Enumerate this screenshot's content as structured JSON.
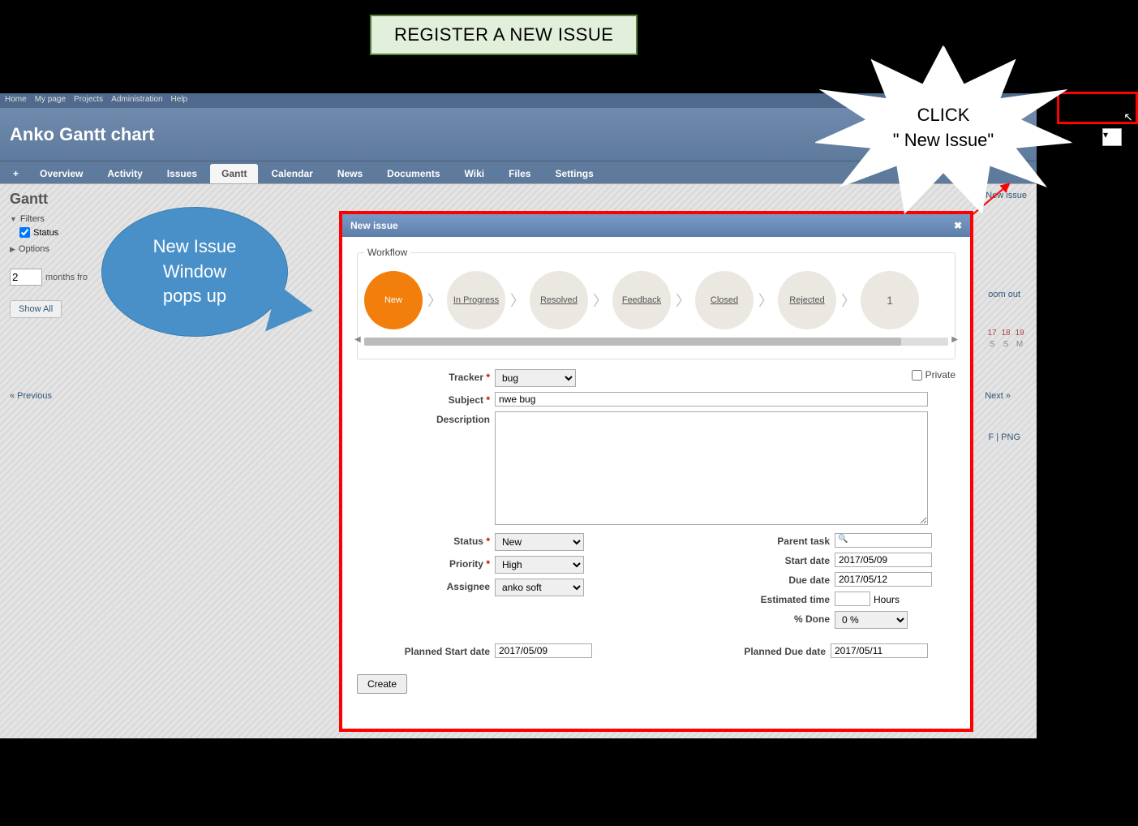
{
  "banner": "REGISTER A NEW ISSUE",
  "starburst": {
    "line1": "CLICK",
    "line2": "\" New Issue\""
  },
  "bubble": {
    "line1": "New Issue",
    "line2": "Window",
    "line3": "pops up"
  },
  "topnav": [
    "Home",
    "My page",
    "Projects",
    "Administration",
    "Help"
  ],
  "project_title": "Anko Gantt chart",
  "tabs": {
    "plus": "+",
    "items": [
      "Overview",
      "Activity",
      "Issues",
      "Gantt",
      "Calendar",
      "News",
      "Documents",
      "Wiki",
      "Files",
      "Settings"
    ],
    "active": "Gantt"
  },
  "page_heading": "Gantt",
  "new_issue_link": "New issue",
  "filters_label": "Filters",
  "status_label": "Status",
  "options_label": "Options",
  "months_value": "2",
  "months_label": "months fro",
  "zoom_out": "oom out",
  "show_all": "Show All",
  "prev": "« Previous",
  "next": "Next »",
  "export": "F | PNG",
  "cal_days": [
    "17",
    "18",
    "19"
  ],
  "cal_wd": [
    "S",
    "S",
    "M"
  ],
  "modal": {
    "title": "New issue",
    "workflow_legend": "Workflow",
    "steps": [
      "New",
      "In Progress",
      "Resolved",
      "Feedback",
      "Closed",
      "Rejected",
      "1"
    ],
    "tracker_label": "Tracker",
    "tracker_value": "bug",
    "private_label": "Private",
    "subject_label": "Subject",
    "subject_value": "nwe bug",
    "description_label": "Description",
    "status_label": "Status",
    "status_value": "New",
    "priority_label": "Priority",
    "priority_value": "High",
    "assignee_label": "Assignee",
    "assignee_value": "anko soft",
    "parent_label": "Parent task",
    "startdate_label": "Start date",
    "startdate_value": "2017/05/09",
    "duedate_label": "Due date",
    "duedate_value": "2017/05/12",
    "esttime_label": "Estimated time",
    "esttime_unit": "Hours",
    "done_label": "% Done",
    "done_value": "0 %",
    "pstart_label": "Planned Start date",
    "pstart_value": "2017/05/09",
    "pdue_label": "Planned Due date",
    "pdue_value": "2017/05/11",
    "create_btn": "Create"
  }
}
